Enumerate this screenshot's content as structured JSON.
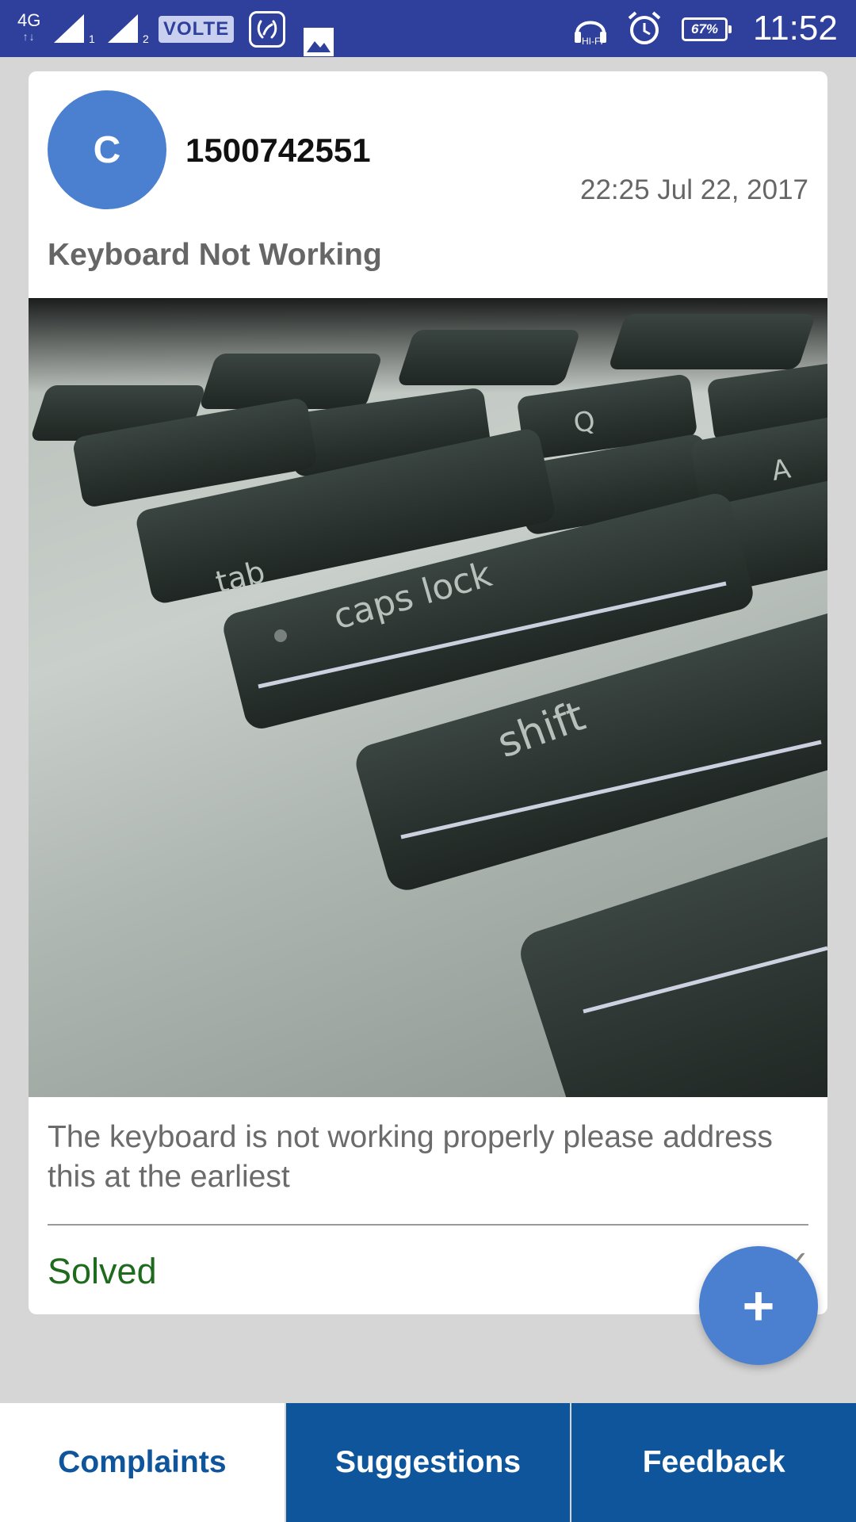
{
  "status_bar": {
    "network": "4G",
    "network_arrows": "↑↓",
    "sim1": "1",
    "sim2": "2",
    "volte": "VOLTE",
    "hifi": "HI-FI",
    "battery": "67%",
    "time": "11:52"
  },
  "post": {
    "avatar_letter": "C",
    "user_id": "1500742551",
    "timestamp": "22:25 Jul 22, 2017",
    "title": "Keyboard Not Working",
    "photo_keys": [
      "tab",
      "caps lock",
      "shift",
      "Q",
      "A"
    ],
    "description": "The keyboard is not working properly please address this at the earliest",
    "status": "Solved",
    "status_icon": "check-icon"
  },
  "fab": {
    "label": "+"
  },
  "tabs": [
    {
      "label": "Complaints",
      "active": true
    },
    {
      "label": "Suggestions",
      "active": false
    },
    {
      "label": "Feedback",
      "active": false
    }
  ],
  "colors": {
    "status_bar": "#2e3f9c",
    "accent": "#4a80cf",
    "tab_bar": "#0f559c",
    "solved": "#1e6b1e"
  }
}
